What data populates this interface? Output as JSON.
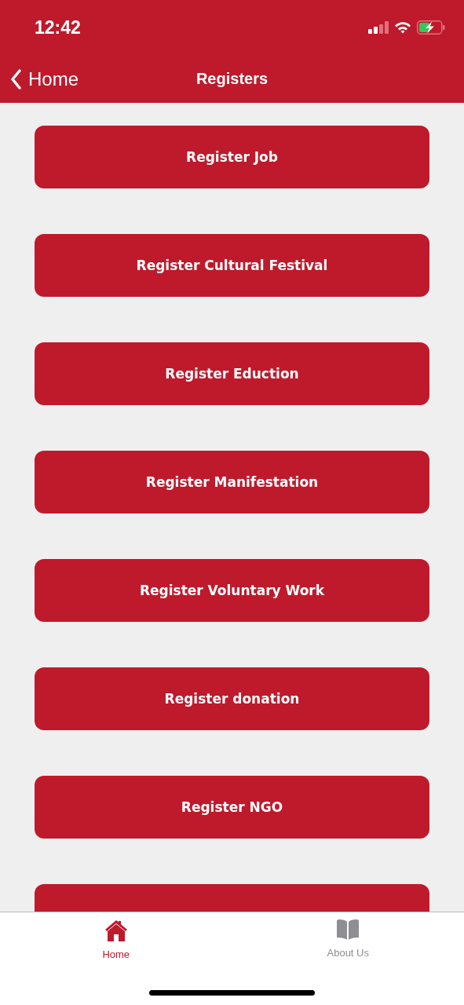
{
  "status_bar": {
    "time": "12:42"
  },
  "nav_bar": {
    "back_label": "Home",
    "title": "Registers"
  },
  "buttons": [
    {
      "kind": "full",
      "label": "Register Job"
    },
    {
      "kind": "full",
      "label": "Register Cultural Festival"
    },
    {
      "kind": "full",
      "label": "Register Eduction"
    },
    {
      "kind": "full",
      "label": "Register Manifestation"
    },
    {
      "kind": "full",
      "label": "Register Voluntary Work"
    },
    {
      "kind": "full",
      "label": "Register donation"
    },
    {
      "kind": "full",
      "label": "Register NGO"
    },
    {
      "kind": "cut-off"
    }
  ],
  "tab_bar": [
    {
      "label": "Home",
      "kind": "home",
      "selected": true
    },
    {
      "label": "About Us",
      "kind": "book",
      "selected": false
    }
  ]
}
